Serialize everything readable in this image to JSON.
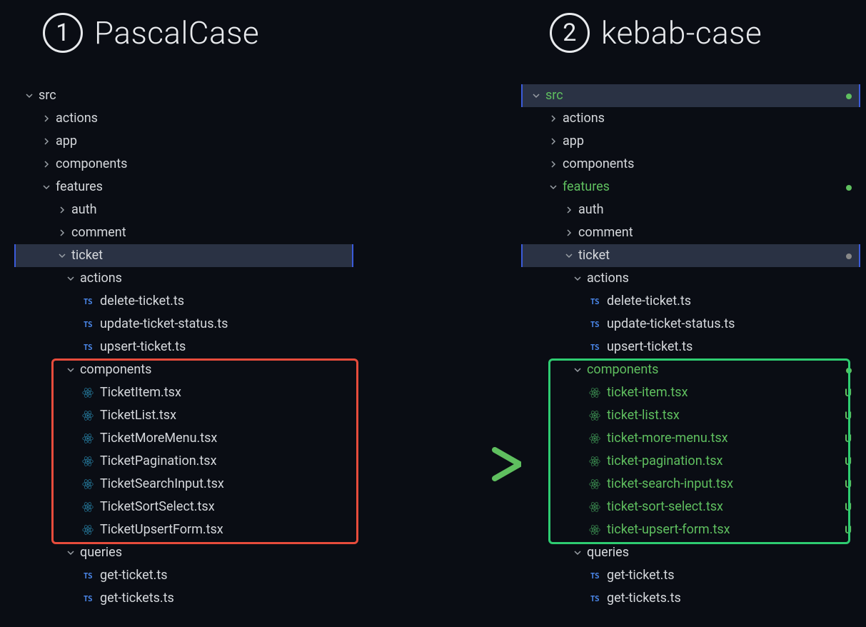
{
  "headings": {
    "left_num": "1",
    "left_title": "PascalCase",
    "right_num": "2",
    "right_title": "kebab-case"
  },
  "left": {
    "src": "src",
    "actions": "actions",
    "app": "app",
    "components_top": "components",
    "features": "features",
    "auth": "auth",
    "comment": "comment",
    "ticket": "ticket",
    "ticket_actions": "actions",
    "f_del": "delete-ticket.ts",
    "f_upd": "update-ticket-status.ts",
    "f_ups": "upsert-ticket.ts",
    "components_sub": "components",
    "c0": "TicketItem.tsx",
    "c1": "TicketList.tsx",
    "c2": "TicketMoreMenu.tsx",
    "c3": "TicketPagination.tsx",
    "c4": "TicketSearchInput.tsx",
    "c5": "TicketSortSelect.tsx",
    "c6": "TicketUpsertForm.tsx",
    "queries": "queries",
    "q0": "get-ticket.ts",
    "q1": "get-tickets.ts"
  },
  "right": {
    "src": "src",
    "actions": "actions",
    "app": "app",
    "components_top": "components",
    "features": "features",
    "auth": "auth",
    "comment": "comment",
    "ticket": "ticket",
    "ticket_actions": "actions",
    "f_del": "delete-ticket.ts",
    "f_upd": "update-ticket-status.ts",
    "f_ups": "upsert-ticket.ts",
    "components_sub": "components",
    "c0": "ticket-item.tsx",
    "c1": "ticket-list.tsx",
    "c2": "ticket-more-menu.tsx",
    "c3": "ticket-pagination.tsx",
    "c4": "ticket-search-input.tsx",
    "c5": "ticket-sort-select.tsx",
    "c6": "ticket-upsert-form.tsx",
    "queries": "queries",
    "q0": "get-ticket.ts",
    "q1": "get-tickets.ts",
    "status_u": "U"
  },
  "icons": {
    "ts": "TS"
  },
  "colors": {
    "red": "#e74c3c",
    "green": "#2ecc71",
    "arrow_start": "#e74c3c",
    "arrow_end": "#5fbf5f"
  }
}
